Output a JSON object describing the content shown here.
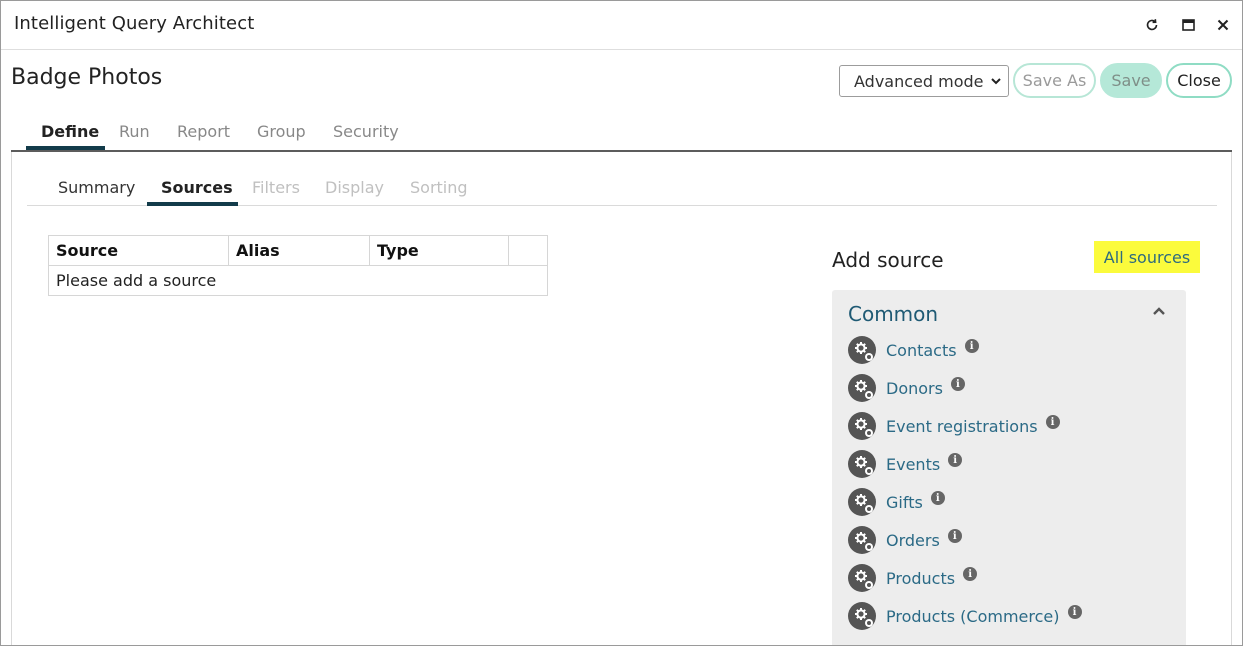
{
  "window": {
    "title": "Intelligent Query Architect",
    "controls": [
      "refresh-icon",
      "maximize-icon",
      "close-icon"
    ]
  },
  "page": {
    "title": "Badge Photos"
  },
  "toolbar": {
    "mode_value": "Advanced mode",
    "save_as_label": "Save As",
    "save_label": "Save",
    "close_label": "Close"
  },
  "main_tabs": [
    {
      "label": "Define",
      "active": true
    },
    {
      "label": "Run",
      "active": false
    },
    {
      "label": "Report",
      "active": false
    },
    {
      "label": "Group",
      "active": false
    },
    {
      "label": "Security",
      "active": false
    }
  ],
  "sub_tabs": [
    {
      "label": "Summary",
      "state": "normal"
    },
    {
      "label": "Sources",
      "state": "active"
    },
    {
      "label": "Filters",
      "state": "disabled"
    },
    {
      "label": "Display",
      "state": "disabled"
    },
    {
      "label": "Sorting",
      "state": "disabled"
    }
  ],
  "sources_table": {
    "columns": [
      "Source",
      "Alias",
      "Type",
      ""
    ],
    "empty_message": "Please add a source"
  },
  "add_source": {
    "title": "Add source",
    "all_sources_label": "All sources",
    "group_title": "Common",
    "items": [
      {
        "label": "Contacts"
      },
      {
        "label": "Donors"
      },
      {
        "label": "Event registrations"
      },
      {
        "label": "Events"
      },
      {
        "label": "Gifts"
      },
      {
        "label": "Orders"
      },
      {
        "label": "Products"
      },
      {
        "label": "Products (Commerce)"
      }
    ],
    "info_glyph": "i"
  },
  "colors": {
    "accent_dark": "#123b4a",
    "link": "#2b6a86",
    "highlight": "#fbfb3c",
    "save_green": "#b5e8d8"
  }
}
